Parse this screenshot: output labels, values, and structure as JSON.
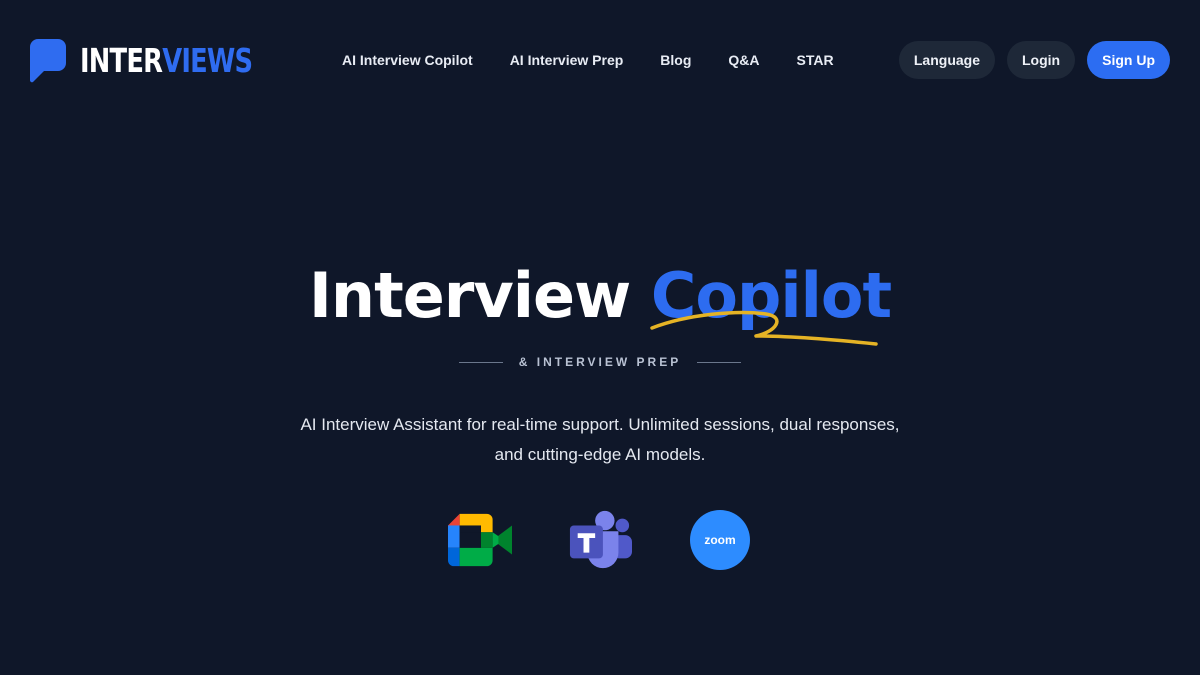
{
  "header": {
    "logo": {
      "part1": "INTER",
      "part2": "VIEWS",
      "icon": "speech-bubble-icon"
    },
    "nav": [
      {
        "label": "AI Interview Copilot"
      },
      {
        "label": "AI Interview Prep"
      },
      {
        "label": "Blog"
      },
      {
        "label": "Q&A"
      },
      {
        "label": "STAR"
      }
    ],
    "actions": {
      "language": "Language",
      "login": "Login",
      "signup": "Sign Up"
    }
  },
  "hero": {
    "title_part1": "Interview",
    "title_part2": "Copilot",
    "subtitle": "& INTERVIEW PREP",
    "description": "AI Interview Assistant for real-time support. Unlimited sessions, dual responses, and cutting-edge AI models.",
    "platforms": [
      {
        "name": "google-meet-icon"
      },
      {
        "name": "microsoft-teams-icon"
      },
      {
        "name": "zoom-icon",
        "label": "zoom"
      }
    ]
  },
  "colors": {
    "background": "#0f1729",
    "accent": "#2c6df2",
    "underline": "#e5b325",
    "pill": "#1e2838"
  }
}
